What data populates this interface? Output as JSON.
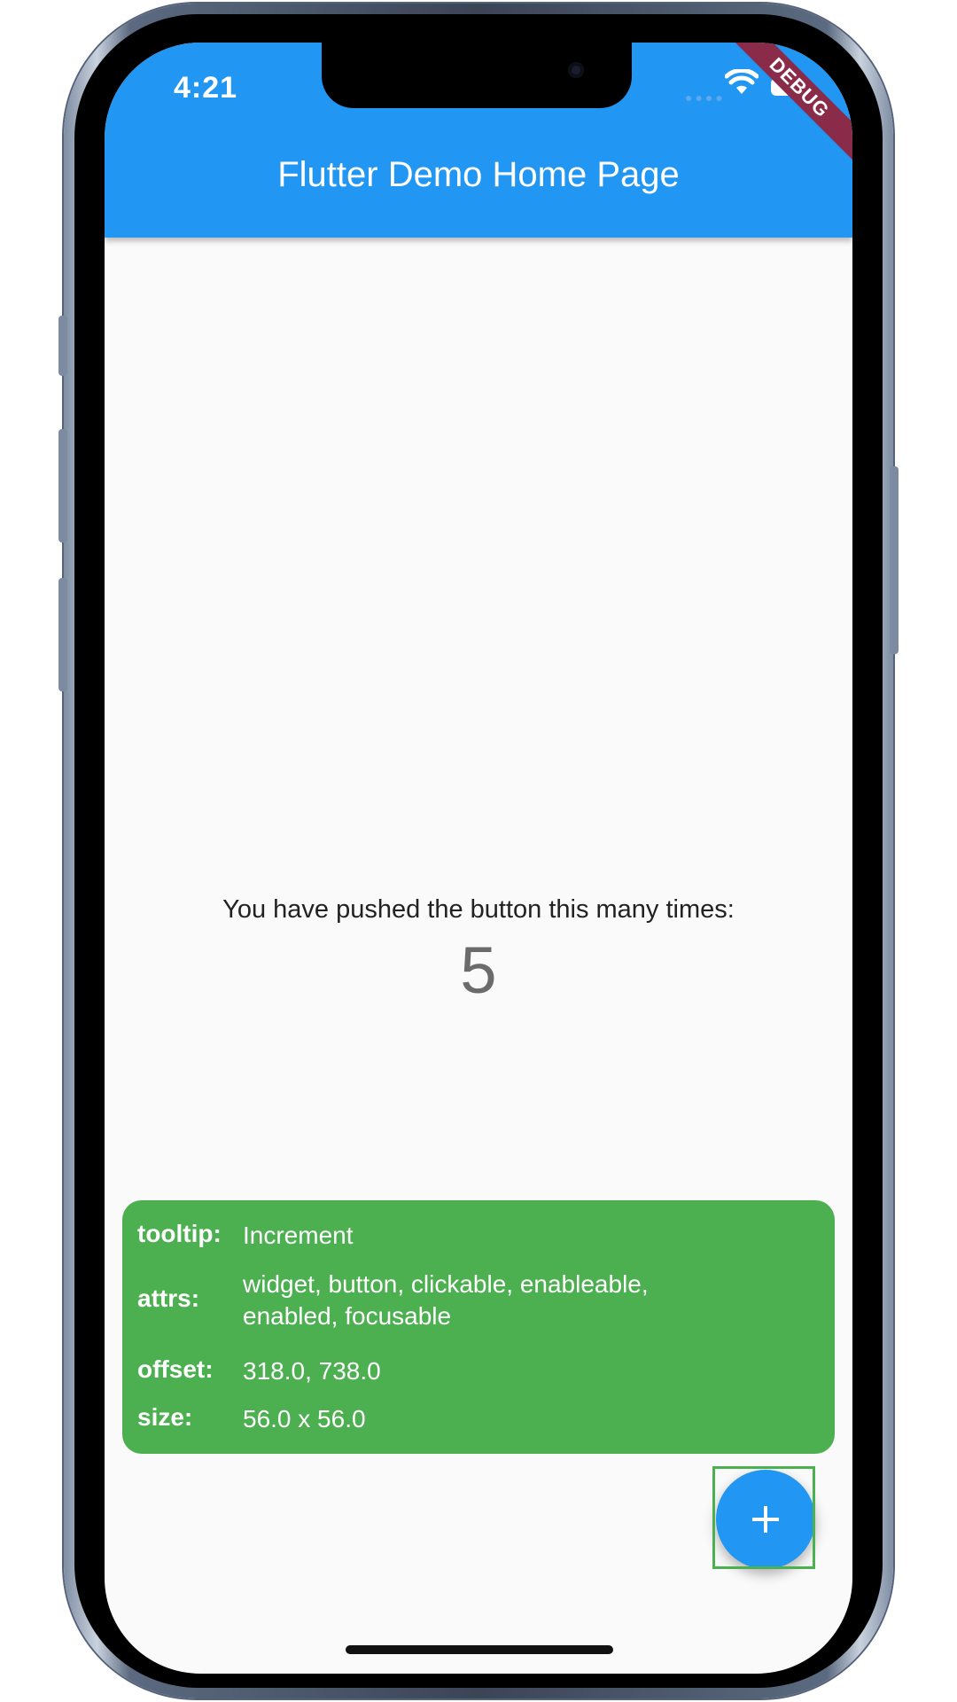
{
  "status_bar": {
    "time": "4:21"
  },
  "debug_banner": "DEBUG",
  "app_bar": {
    "title": "Flutter Demo Home Page"
  },
  "counter": {
    "label": "You have pushed the button this many times:",
    "value": "5"
  },
  "inspector": {
    "rows": [
      {
        "key": "tooltip:",
        "value": "Increment"
      },
      {
        "key": "attrs:",
        "value": "widget, button, clickable, enableable, enabled, focusable"
      },
      {
        "key": "offset:",
        "value": "318.0, 738.0"
      },
      {
        "key": "size:",
        "value": "56.0 x 56.0"
      }
    ]
  },
  "fab": {
    "icon": "plus-icon"
  },
  "colors": {
    "primary": "#2196f3",
    "inspector": "#4caf50",
    "debug": "#8b2b4a",
    "background": "#fafafa"
  }
}
